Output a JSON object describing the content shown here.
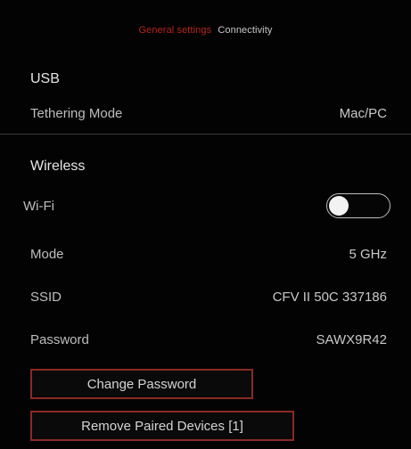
{
  "breadcrumb": {
    "parent": "General settings",
    "current": "Connectivity"
  },
  "usb": {
    "heading": "USB",
    "tethering_label": "Tethering Mode",
    "tethering_value": "Mac/PC"
  },
  "wireless": {
    "heading": "Wireless",
    "wifi_label": "Wi-Fi",
    "wifi_enabled": false,
    "mode_label": "Mode",
    "mode_value": "5 GHz",
    "ssid_label": "SSID",
    "ssid_value": "CFV II 50C 337186",
    "password_label": "Password",
    "password_value": "SAWX9R42"
  },
  "buttons": {
    "change_password": "Change Password",
    "remove_paired": "Remove Paired Devices [1]"
  },
  "colors": {
    "accent": "#b8231c",
    "button_border": "#8a2a24"
  }
}
